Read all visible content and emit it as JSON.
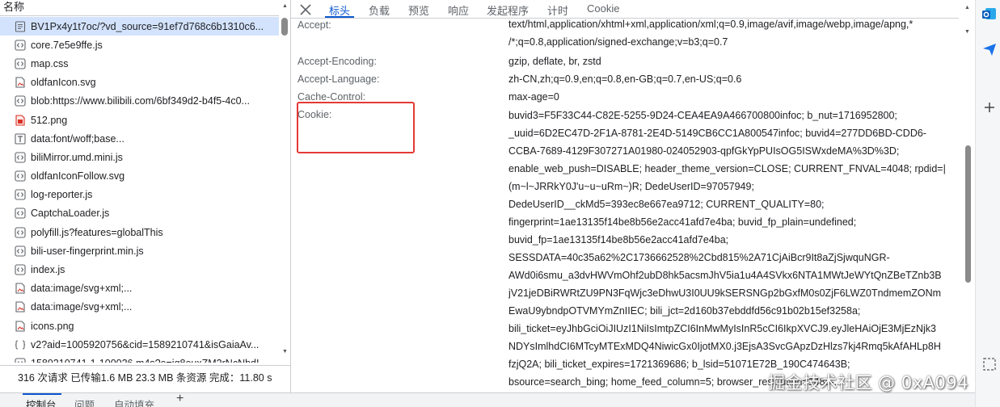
{
  "request_list": {
    "header_label": "名称",
    "items": [
      {
        "label": "BV1Px4y1t7oc/?vd_source=91ef7d768c6b1310c6...",
        "icon": "document-icon",
        "selected": true
      },
      {
        "label": "core.7e5e9ffe.js",
        "icon": "script-icon"
      },
      {
        "label": "map.css",
        "icon": "stylesheet-icon"
      },
      {
        "label": "oldfanIcon.svg",
        "icon": "image-file-icon"
      },
      {
        "label": "blob:https://www.bilibili.com/6bf349d2-b4f5-4c0...",
        "icon": "script-icon"
      },
      {
        "label": "512.png",
        "icon": "png-image-icon"
      },
      {
        "label": "data:font/woff;base...",
        "icon": "font-icon"
      },
      {
        "label": "biliMirror.umd.mini.js",
        "icon": "script-icon"
      },
      {
        "label": "oldfanIconFollow.svg",
        "icon": "script-icon"
      },
      {
        "label": "log-reporter.js",
        "icon": "script-icon"
      },
      {
        "label": "CaptchaLoader.js",
        "icon": "script-icon"
      },
      {
        "label": "polyfill.js?features=globalThis",
        "icon": "script-icon"
      },
      {
        "label": "bili-user-fingerprint.min.js",
        "icon": "script-icon"
      },
      {
        "label": "index.js",
        "icon": "script-icon"
      },
      {
        "label": "data:image/svg+xml;...",
        "icon": "image-file-icon"
      },
      {
        "label": "data:image/svg+xml;...",
        "icon": "image-file-icon"
      },
      {
        "label": "icons.png",
        "icon": "image-file-icon"
      },
      {
        "label": "v2?aid=1005920756&cid=1589210741&isGaiaAv...",
        "icon": "fetch-icon"
      },
      {
        "label": "1589210741-1-100026.m4s?e=ig8euxZM2rNcNbdI...",
        "icon": "script-icon"
      }
    ]
  },
  "status_bar": {
    "text": "316 次请求  已传输1.6 MB  23.3 MB 条资源  完成：11.80 s"
  },
  "detail_tabs": {
    "close_icon": "close-icon",
    "tabs": [
      "标头",
      "负载",
      "预览",
      "响应",
      "发起程序",
      "计时",
      "Cookie"
    ],
    "active": "标头"
  },
  "request_headers": [
    {
      "name": "Accept:",
      "value_lines": [
        "text/html,application/xhtml+xml,application/xml;q=0.9,image/avif,image/webp,image/apng,*",
        "/*;q=0.8,application/signed-exchange;v=b3;q=0.7"
      ]
    },
    {
      "name": "Accept-Encoding:",
      "value_lines": [
        "gzip, deflate, br, zstd"
      ]
    },
    {
      "name": "Accept-Language:",
      "value_lines": [
        "zh-CN,zh;q=0.9,en;q=0.8,en-GB;q=0.7,en-US;q=0.6"
      ]
    },
    {
      "name": "Cache-Control:",
      "value_lines": [
        "max-age=0"
      ]
    },
    {
      "name": "Cookie:",
      "value_lines": [
        "buvid3=F5F33C44-C82E-5255-9D24-CEA4EA9A466700800infoc; b_nut=1716952800;",
        "_uuid=6D2EC47D-2F1A-8781-2E4D-5149CB6CC1A800547infoc; buvid4=277DD6BD-CDD6-",
        "CCBA-7689-4129F307271A01980-024052903-qpfGkYpPUIsOG5ISWxdeMA%3D%3D;",
        "enable_web_push=DISABLE; header_theme_version=CLOSE; CURRENT_FNVAL=4048; rpdid=|",
        "(m~l~JRRkY0J'u~u~uRm~)R; DedeUserID=97057949;",
        "DedeUserID__ckMd5=393ec8e667ea9712; CURRENT_QUALITY=80;",
        "fingerprint=1ae13135f14be8b56e2acc41afd7e4ba; buvid_fp_plain=undefined;",
        "buvid_fp=1ae13135f14be8b56e2acc41afd7e4ba;",
        "SESSDATA=40c35a62%2C1736662528%2Cbd815%2A71CjAiBcr9It8aZjSjwquNGR-",
        "AWd0i6smu_a3dvHWVmOhf2ubD8hk5acsmJhV5ia1u4A4SVkx6NTA1MWtJeWYtQnZBeTZnb3B",
        "jV21jeDBiRWRtZU9PN3FqWjc3eDhwU3I0UU9kSERSNGp2bGxfM0s0ZjF6LWZ0TndmemZONm",
        "EwaU9ybndpOTVMYmZnIIEC; bili_jct=2d160b37ebddfd56c91b02b15ef3258a;",
        "bili_ticket=eyJhbGciOiJIUzI1NiIsImtpZCI6InMwMyIsInR5cCI6IkpXVCJ9.eyJleHAiOjE3MjEzNjk3",
        "NDYsImlhdCI6MTcyMTExMDQ4NiwicGx0IjotMX0.j3EjsA3SvcGApzDzHlzs7kj4Rmq5kAfAHLp8H",
        "fzjQ2A; bili_ticket_expires=1721369686; b_lsid=51071E72B_190C474643B;",
        "bsource=search_bing; home_feed_column=5; browser_resolution=1488-..."
      ]
    }
  ],
  "drawer_tabs": [
    "控制台",
    "问题",
    "自动填充"
  ],
  "watermark": "掘金技术社区 @ 0xA094",
  "colors": {
    "accent": "#0b57d0",
    "highlight_box": "#e53935",
    "selected_row": "#d3e3fd"
  }
}
